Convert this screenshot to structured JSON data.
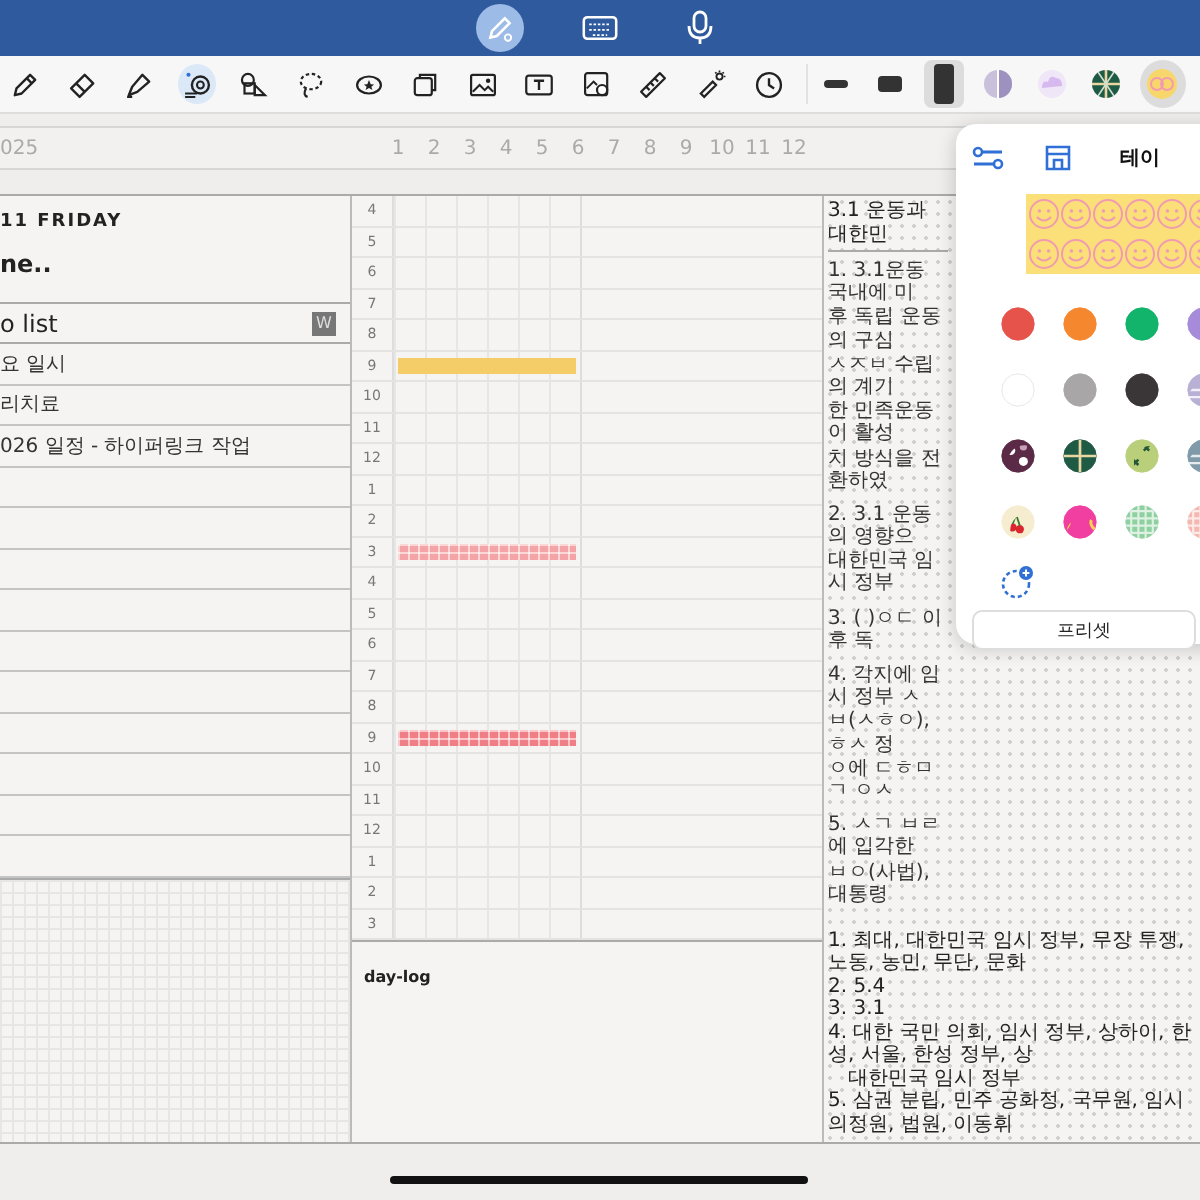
{
  "mode_bar": [
    {
      "kind": "pen",
      "selected": true
    },
    {
      "kind": "keyboard",
      "selected": false
    },
    {
      "kind": "mic",
      "selected": false
    }
  ],
  "tools": [
    {
      "kind": "pen",
      "selected": false
    },
    {
      "kind": "eraser",
      "selected": false
    },
    {
      "kind": "highlighter",
      "selected": false
    },
    {
      "kind": "tape",
      "selected": true
    },
    {
      "kind": "shapes",
      "selected": false
    },
    {
      "kind": "lasso",
      "selected": false
    },
    {
      "kind": "sticker",
      "selected": false
    },
    {
      "kind": "pages",
      "selected": false
    },
    {
      "kind": "image",
      "selected": false
    },
    {
      "kind": "textbox",
      "selected": false
    },
    {
      "kind": "image-scan",
      "selected": false
    },
    {
      "kind": "ruler",
      "selected": false
    },
    {
      "kind": "laser",
      "selected": false
    },
    {
      "kind": "clock",
      "selected": false
    }
  ],
  "presets": [
    {
      "kind": "thin",
      "selected": false
    },
    {
      "kind": "medium",
      "selected": false
    },
    {
      "kind": "thick",
      "selected": true
    },
    {
      "kind": "half",
      "selected": false
    },
    {
      "kind": "cloud",
      "selected": false
    },
    {
      "kind": "plaid",
      "selected": false
    },
    {
      "kind": "smiley",
      "selected": true
    }
  ],
  "ruler": {
    "year": "025",
    "months": [
      "1",
      "2",
      "3",
      "4",
      "5",
      "6",
      "7",
      "8",
      "9",
      "10",
      "11",
      "12"
    ]
  },
  "day": {
    "date": "11 FRIDAY",
    "note": "ne..",
    "todo_title": "o list",
    "todo_badge": "W",
    "todos": [
      "요 일시",
      "리치료",
      "026 일정 - 하이퍼링크 작업"
    ]
  },
  "timeline": {
    "hours": [
      {
        "label": "4"
      },
      {
        "label": "5"
      },
      {
        "label": "6"
      },
      {
        "label": "7"
      },
      {
        "label": "8"
      },
      {
        "label": "9",
        "tape": {
          "kind": "plain",
          "color": "#f5cd68"
        }
      },
      {
        "label": "10"
      },
      {
        "label": "11"
      },
      {
        "label": "12"
      },
      {
        "label": "1"
      },
      {
        "label": "2"
      },
      {
        "label": "3",
        "tape": {
          "kind": "checkered",
          "color": "#f4a3a6"
        }
      },
      {
        "label": "4"
      },
      {
        "label": "5"
      },
      {
        "label": "6"
      },
      {
        "label": "7"
      },
      {
        "label": "8"
      },
      {
        "label": "9",
        "tape": {
          "kind": "checkered",
          "color": "#ef7f84"
        }
      },
      {
        "label": "10"
      },
      {
        "label": "11"
      },
      {
        "label": "12"
      },
      {
        "label": "1"
      },
      {
        "label": "2"
      },
      {
        "label": "3"
      }
    ],
    "log_title": "day-log"
  },
  "notes": {
    "title": "3.1 운동과 대한민",
    "lines": [
      "1. 3.1운동 국내에 미",
      "후 독립 운동의 구심",
      "ㅅㅈㅂ 수립의 계기",
      "한 민족운동이 활성",
      "치 방식을 전환하였",
      "2. 3.1 운동의 영향으",
      "대한민국 임시 정부",
      "3. (      )ㅇㄷ 이후 독",
      "4. 각지에 임시 정부 ㅅ",
      "ㅂ(ㅅㅎㅇ), ㅎㅅ 정",
      "ㅇ에 ㄷㅎㅁㄱ ㅇㅅ",
      "5. ㅅㄱ ㅂㄹ에 입각한",
      "ㅂㅇ(사법), 대통령"
    ],
    "answers": [
      "1. 최대, 대한민국 임시 정부, 무장 투쟁, 노동, 농민, 무단, 문화",
      "2. 5.4",
      "3. 3.1",
      "4. 대한 국민 의회, 임시 정부, 상하이, 한성, 서울, 한성 정부, 상",
      "대한민국 임시 정부",
      "5. 삼권 분립, 민주 공화정, 국무원, 임시 의정원, 법원, 이동휘"
    ]
  },
  "tape_popover": {
    "title": "테이",
    "swatches": [
      {
        "kind": "solid",
        "color": "#e5534b"
      },
      {
        "kind": "solid",
        "color": "#f5872f"
      },
      {
        "kind": "solid",
        "color": "#12b36b"
      },
      {
        "kind": "solid",
        "color": "#a78bdb"
      },
      {
        "kind": "solid",
        "color": "#ffffff"
      },
      {
        "kind": "solid",
        "color": "#a8a6a6"
      },
      {
        "kind": "solid",
        "color": "#3a3637"
      },
      {
        "kind": "stripe",
        "color": "#b9b0d6"
      },
      {
        "kind": "dots",
        "color": "#5a2a46"
      },
      {
        "kind": "plaid",
        "color": "#1f5a45"
      },
      {
        "kind": "cross",
        "color": "#b9cf7a"
      },
      {
        "kind": "stripe",
        "color": "#7f9aa8"
      },
      {
        "kind": "cherry",
        "color": "#f6ecd0"
      },
      {
        "kind": "ball",
        "color": "#f03fa0"
      },
      {
        "kind": "gingham",
        "color": "#8fd0a0"
      },
      {
        "kind": "gingham",
        "color": "#f5b8b0"
      }
    ],
    "preset_button": "프리셋"
  }
}
